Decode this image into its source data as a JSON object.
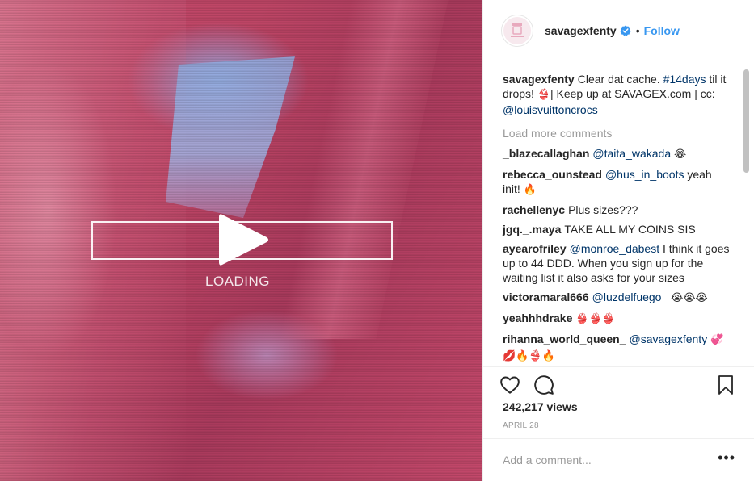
{
  "colors": {
    "accent": "#3897f0",
    "mention": "#003569",
    "text": "#262626",
    "muted": "#999999",
    "media_tint": "#c64a6c"
  },
  "media": {
    "loading_label": "LOADING",
    "play_icon": "play-icon"
  },
  "header": {
    "username": "savagexfenty",
    "verified_icon": "verified-badge-icon",
    "separator": "•",
    "follow_label": "Follow"
  },
  "caption": {
    "username": "savagexfenty",
    "text_1": "Clear dat cache. ",
    "hashtag": "#14days",
    "text_2": " til it drops! ",
    "emoji": "👙",
    "text_3": "| Keep up at SAVAGEX.com | cc: ",
    "mention": "@louisvuittoncrocs"
  },
  "load_more": "Load more comments",
  "comments": [
    {
      "user": "_blazecallaghan",
      "mention": "@taita_wakada",
      "text": "",
      "emoji": "😂"
    },
    {
      "user": "rebecca_ounstead",
      "mention": "@hus_in_boots",
      "text": " yeah init!",
      "emoji": "🔥"
    },
    {
      "user": "rachellenyc",
      "mention": "",
      "text": "Plus sizes???",
      "emoji": ""
    },
    {
      "user": "jgq._.maya",
      "mention": "",
      "text": "TAKE ALL MY COINS SIS",
      "emoji": ""
    },
    {
      "user": "ayearofriley",
      "mention": "@monroe_dabest",
      "text": " I think it goes up to 44 DDD. When you sign up for the waiting list it also asks for your sizes",
      "emoji": ""
    },
    {
      "user": "victoramaral666",
      "mention": "@luzdelfuego_",
      "text": " ",
      "emoji": "😭😭😭"
    },
    {
      "user": "yeahhhdrake",
      "mention": "",
      "text": "",
      "emoji": "👙👙👙"
    },
    {
      "user": "rihanna_world_queen_",
      "mention": "@savagexfenty",
      "text": " ",
      "emoji": "💞💋🔥👙🔥"
    }
  ],
  "actions": {
    "like_icon": "heart-icon",
    "comment_icon": "comment-icon",
    "save_icon": "bookmark-icon"
  },
  "views": "242,217 views",
  "date": "APRIL 28",
  "comment_box": {
    "placeholder": "Add a comment...",
    "value": "",
    "more_label": "•••"
  }
}
